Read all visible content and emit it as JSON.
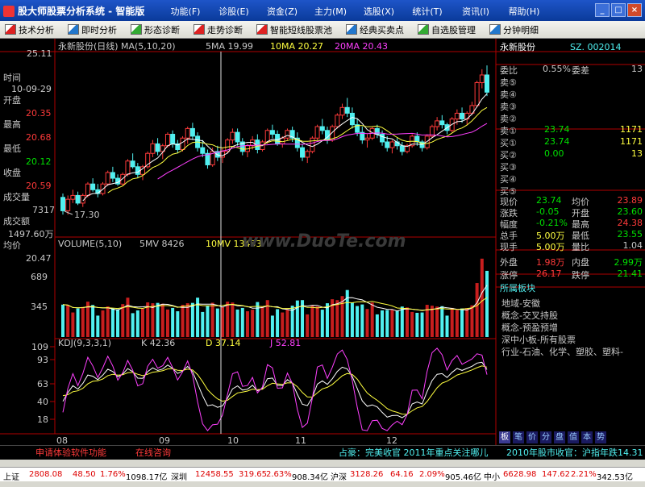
{
  "app": {
    "title": "股大师股票分析系统 - 智能版"
  },
  "menu": [
    "功能(F)",
    "诊股(E)",
    "资金(Z)",
    "主力(M)",
    "选股(X)",
    "统计(T)",
    "资讯(I)",
    "帮助(H)"
  ],
  "window_buttons": [
    "_",
    "□",
    "×"
  ],
  "toolbar": [
    "技术分析",
    "即时分析",
    "形态诊断",
    "走势诊断",
    "智能短线股票池",
    "经典买卖点",
    "自选股管理",
    "分钟明细"
  ],
  "chart_header": {
    "name": "永新股份(日线)",
    "ma_label": "MA(5,10,20)",
    "ma5": "5MA 19.99",
    "ma10": "10MA 20.27",
    "ma20": "20MA 20.43"
  },
  "vol_header": {
    "label": "VOLUME(5,10)",
    "mv5": "5MV 8426",
    "mv10": "10MV 13453"
  },
  "kdj_header": {
    "label": "KDJ(9,3,3,1)",
    "k": "K 42.36",
    "d": "D 37.14",
    "j": "J 52.81"
  },
  "price_axis": {
    "top": "25.11",
    "low_mark": "17.30"
  },
  "vol_axis": [
    "689",
    "345"
  ],
  "kdj_axis": [
    "109",
    "93",
    "63",
    "40",
    "18"
  ],
  "x_labels": [
    "08",
    "09",
    "10",
    "11",
    "12"
  ],
  "cursor_info": {
    "time_label": "时间",
    "time": "10-09-29",
    "open_label": "开盘",
    "open": "20.35",
    "high_label": "最高",
    "high": "20.68",
    "low_label": "最低",
    "low": "20.12",
    "close_label": "收盘",
    "close": "20.59",
    "vol_label": "成交量",
    "vol": "7317",
    "amt_label": "成交额",
    "amt": "1497.60万",
    "avg_label": "均价",
    "avg": "20.47"
  },
  "quote": {
    "name": "永新股份",
    "code": "SZ. 002014",
    "wb_label": "委比",
    "wb": "0.55%",
    "wc_label": "委差",
    "wc": "13",
    "sell": [
      {
        "l": "卖⑤",
        "p": "",
        "v": ""
      },
      {
        "l": "卖④",
        "p": "",
        "v": ""
      },
      {
        "l": "卖③",
        "p": "",
        "v": ""
      },
      {
        "l": "卖②",
        "p": "",
        "v": ""
      },
      {
        "l": "卖①",
        "p": "23.74",
        "v": "1171"
      }
    ],
    "buy": [
      {
        "l": "买①",
        "p": "23.74",
        "v": "1171"
      },
      {
        "l": "买②",
        "p": "0.00",
        "v": "13"
      },
      {
        "l": "买③",
        "p": "",
        "v": ""
      },
      {
        "l": "买④",
        "p": "",
        "v": ""
      },
      {
        "l": "买⑤",
        "p": "",
        "v": ""
      }
    ],
    "stats": [
      {
        "a": "现价",
        "b": "23.74",
        "c": "均价",
        "d": "23.89",
        "bc": "gr",
        "dc": "r"
      },
      {
        "a": "涨跌",
        "b": "-0.05",
        "c": "开盘",
        "d": "23.60",
        "bc": "gr",
        "dc": "gr"
      },
      {
        "a": "幅度",
        "b": "-0.21%",
        "c": "最高",
        "d": "24.38",
        "bc": "gr",
        "dc": "r"
      },
      {
        "a": "总手",
        "b": "5.00万",
        "c": "最低",
        "d": "23.55",
        "bc": "y",
        "dc": "gr"
      },
      {
        "a": "现手",
        "b": "5.00万",
        "c": "量比",
        "d": "1.04",
        "bc": "y",
        "dc": "w"
      }
    ],
    "waipan_label": "外盘",
    "waipan": "1.98万",
    "neipan_label": "内盘",
    "neipan": "2.99万",
    "zhangting_label": "涨停",
    "zhangting": "26.17",
    "dieting_label": "跌停",
    "dieting": "21.41",
    "sector_title": "所属板块",
    "sectors": [
      "地域-安徽",
      "概念-交叉持股",
      "概念-预盈预增",
      "深中小板-所有股票",
      "行业-石油、化学、塑胶、塑料-"
    ]
  },
  "side_tabs": [
    "板",
    "笔",
    "价",
    "分",
    "盘",
    "值",
    "本",
    "势"
  ],
  "ticker": {
    "left1": "申请体验软件功能",
    "left2": "在线咨询",
    "news1": "占豪：完美收官 2011年重点关注哪儿",
    "news2": "2010年股市收官：沪指年跌14.31"
  },
  "index_bar": {
    "sh_label": "上证",
    "sh": "2808.08",
    "sh_chg": "48.50",
    "sh_pct": "1.76%",
    "sh_amt": "1098.17亿",
    "sz_label": "深圳",
    "sz": "12458.55",
    "sz_chg": "319.65",
    "sz_pct": "2.63%",
    "sz_amt": "908.34亿",
    "hs_label": "沪深",
    "hs": "3128.26",
    "hs_chg": "64.16",
    "hs_pct": "2.09%",
    "hs_amt": "905.46亿",
    "zx_label": "中小",
    "zx": "6628.98",
    "zx_chg": "147.62",
    "zx_pct": "2.21%",
    "zx_amt": "342.53亿"
  },
  "watermark": "www.DuoTe.com",
  "chart_data": [
    {
      "type": "candlestick",
      "title": "永新股份(日线)",
      "ylim": [
        16.8,
        25.4
      ],
      "candles": [
        [
          18.2,
          18.4,
          17.3,
          17.5
        ],
        [
          17.5,
          18.3,
          17.3,
          18.1
        ],
        [
          18.1,
          18.6,
          17.9,
          18.3
        ],
        [
          18.3,
          18.5,
          17.8,
          17.9
        ],
        [
          17.9,
          18.4,
          17.7,
          18.3
        ],
        [
          18.3,
          19.0,
          18.2,
          18.9
        ],
        [
          18.9,
          19.2,
          18.5,
          18.6
        ],
        [
          18.6,
          18.9,
          18.2,
          18.4
        ],
        [
          18.4,
          19.0,
          18.3,
          18.9
        ],
        [
          18.9,
          19.6,
          18.8,
          19.5
        ],
        [
          19.5,
          19.8,
          19.0,
          19.2
        ],
        [
          19.2,
          19.4,
          18.8,
          18.9
        ],
        [
          18.9,
          19.5,
          18.8,
          19.4
        ],
        [
          19.4,
          20.2,
          19.3,
          20.1
        ],
        [
          20.1,
          20.5,
          19.7,
          19.8
        ],
        [
          19.8,
          20.0,
          19.2,
          19.4
        ],
        [
          19.4,
          19.9,
          19.1,
          19.8
        ],
        [
          19.8,
          20.6,
          19.7,
          20.5
        ],
        [
          20.5,
          21.2,
          20.3,
          21.0
        ],
        [
          21.0,
          21.3,
          20.4,
          20.6
        ],
        [
          20.6,
          21.0,
          20.2,
          20.9
        ],
        [
          20.9,
          21.6,
          20.8,
          21.5
        ],
        [
          21.5,
          21.7,
          20.8,
          21.0
        ],
        [
          21.0,
          21.2,
          20.5,
          20.7
        ],
        [
          20.7,
          21.4,
          20.6,
          21.3
        ],
        [
          21.3,
          21.9,
          21.0,
          21.8
        ],
        [
          21.8,
          22.1,
          21.2,
          21.4
        ],
        [
          21.4,
          21.6,
          20.6,
          20.8
        ],
        [
          20.8,
          21.2,
          20.3,
          20.5
        ],
        [
          20.5,
          20.7,
          19.7,
          19.9
        ],
        [
          19.9,
          20.8,
          19.8,
          20.6
        ],
        [
          20.6,
          20.9,
          20.1,
          20.3
        ],
        [
          20.3,
          20.8,
          20.0,
          20.6
        ],
        [
          20.6,
          21.3,
          20.5,
          21.2
        ],
        [
          21.2,
          21.8,
          21.0,
          21.6
        ],
        [
          21.6,
          21.8,
          20.9,
          21.1
        ],
        [
          21.1,
          21.3,
          20.4,
          20.6
        ],
        [
          20.6,
          21.0,
          20.3,
          20.9
        ],
        [
          20.9,
          21.4,
          20.7,
          21.2
        ],
        [
          21.2,
          21.5,
          20.5,
          20.7
        ],
        [
          20.7,
          21.2,
          20.6,
          21.1
        ],
        [
          21.1,
          21.8,
          21.0,
          21.7
        ],
        [
          21.7,
          22.0,
          21.3,
          21.5
        ],
        [
          21.5,
          21.7,
          20.9,
          21.0
        ],
        [
          21.0,
          21.4,
          20.8,
          21.3
        ],
        [
          21.3,
          21.8,
          21.2,
          21.7
        ],
        [
          21.7,
          21.9,
          21.1,
          21.3
        ],
        [
          21.3,
          21.6,
          20.6,
          20.8
        ],
        [
          20.8,
          21.0,
          20.1,
          20.3
        ],
        [
          20.3,
          20.7,
          20.0,
          20.6
        ],
        [
          20.6,
          21.4,
          20.5,
          21.3
        ],
        [
          21.3,
          22.0,
          21.2,
          21.9
        ],
        [
          21.9,
          22.3,
          21.5,
          21.7
        ],
        [
          21.7,
          21.9,
          21.0,
          21.2
        ],
        [
          21.2,
          22.0,
          21.1,
          21.9
        ],
        [
          21.9,
          22.6,
          21.8,
          22.5
        ],
        [
          22.5,
          23.1,
          22.3,
          22.9
        ],
        [
          22.9,
          23.4,
          22.4,
          22.6
        ],
        [
          22.6,
          22.9,
          21.8,
          22.0
        ],
        [
          22.0,
          22.3,
          21.4,
          21.6
        ],
        [
          21.6,
          21.9,
          21.0,
          21.2
        ],
        [
          21.2,
          21.5,
          20.8,
          21.3
        ],
        [
          21.3,
          21.9,
          21.2,
          21.8
        ],
        [
          21.8,
          22.0,
          21.3,
          21.5
        ],
        [
          21.5,
          21.7,
          20.9,
          21.1
        ],
        [
          21.1,
          21.4,
          20.6,
          20.8
        ],
        [
          20.8,
          21.2,
          20.5,
          21.1
        ],
        [
          21.1,
          21.3,
          20.7,
          20.9
        ],
        [
          20.9,
          21.1,
          20.4,
          20.6
        ],
        [
          20.6,
          21.0,
          20.5,
          20.9
        ],
        [
          20.9,
          21.5,
          20.8,
          21.4
        ],
        [
          21.4,
          21.6,
          20.9,
          21.1
        ],
        [
          21.1,
          21.2,
          20.6,
          20.8
        ],
        [
          20.8,
          21.5,
          20.7,
          21.4
        ],
        [
          21.4,
          22.0,
          21.3,
          21.9
        ],
        [
          21.9,
          22.4,
          21.7,
          22.2
        ],
        [
          22.2,
          22.5,
          21.8,
          22.0
        ],
        [
          22.0,
          22.1,
          21.5,
          21.7
        ],
        [
          21.7,
          22.4,
          21.6,
          22.3
        ],
        [
          22.3,
          22.8,
          22.0,
          22.6
        ],
        [
          22.6,
          22.9,
          22.1,
          22.3
        ],
        [
          22.3,
          22.7,
          22.0,
          22.6
        ],
        [
          22.6,
          23.2,
          22.5,
          23.0
        ],
        [
          23.0,
          24.3,
          22.9,
          24.2
        ],
        [
          24.2,
          24.9,
          23.9,
          24.6
        ],
        [
          24.6,
          25.1,
          23.5,
          23.7
        ]
      ]
    },
    {
      "type": "bar",
      "title": "VOLUME(5,10)",
      "ylim": [
        0,
        1000
      ]
    },
    {
      "type": "line",
      "title": "KDJ(9,3,3,1)",
      "ylim": [
        0,
        109
      ],
      "series": [
        {
          "name": "K"
        },
        {
          "name": "D"
        },
        {
          "name": "J"
        }
      ]
    }
  ]
}
